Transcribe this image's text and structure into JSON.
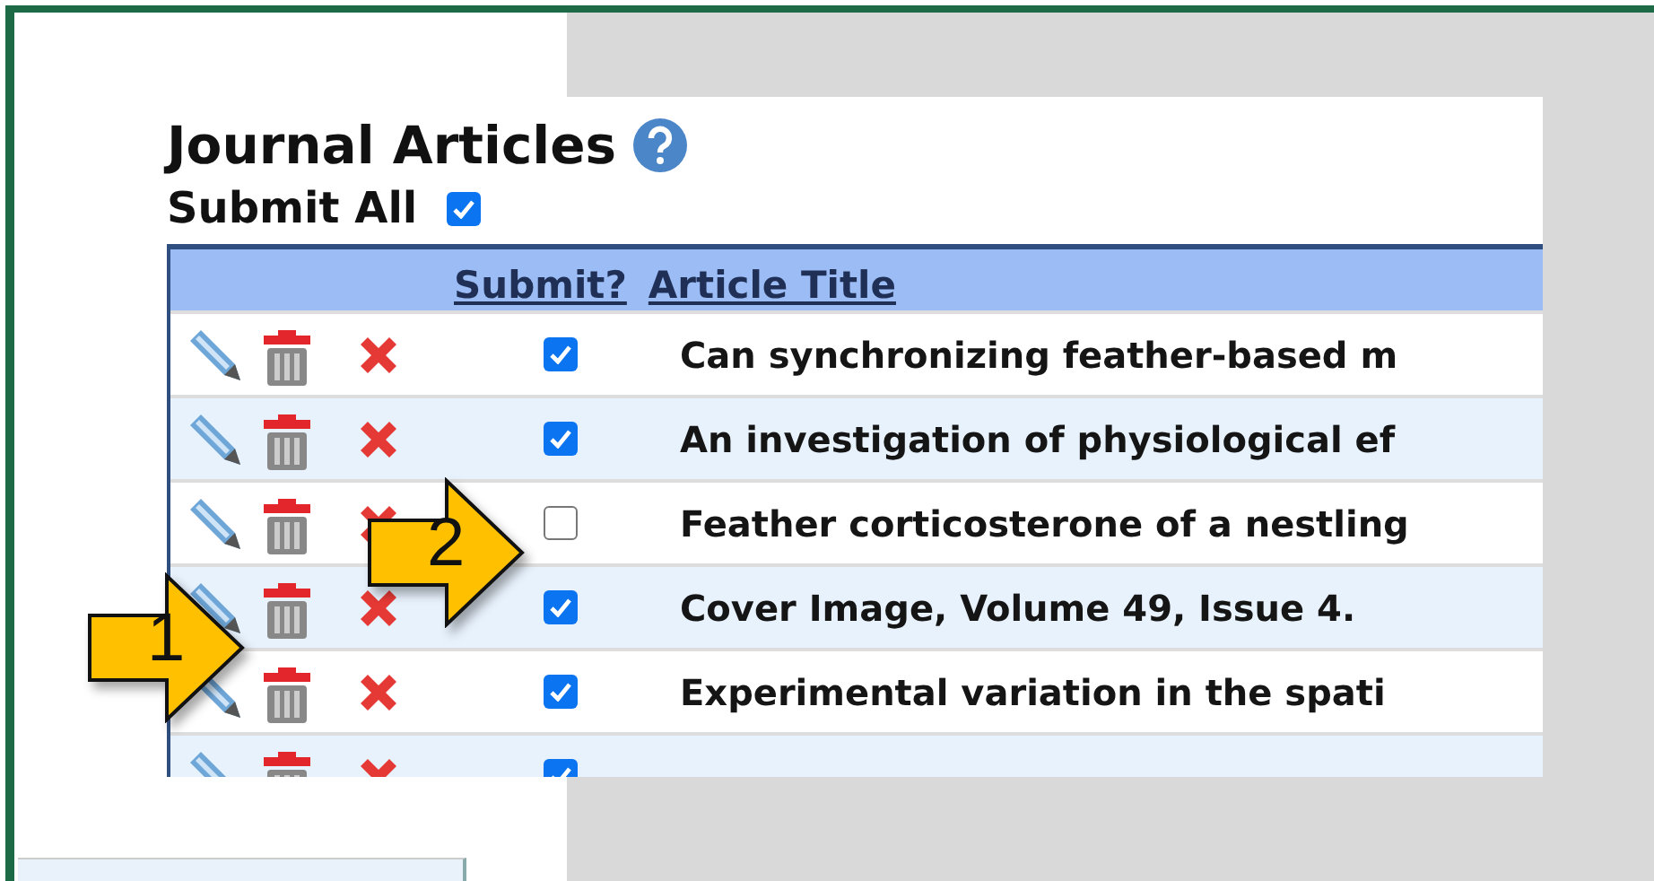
{
  "heading": {
    "title": "Journal Articles"
  },
  "submit_all": {
    "label": "Submit All",
    "checked": true
  },
  "table": {
    "columns": [
      "Submit?",
      "Article Title"
    ],
    "rows": [
      {
        "checked": true,
        "title": "Can synchronizing feather-based m"
      },
      {
        "checked": true,
        "title": "An investigation of physiological ef"
      },
      {
        "checked": false,
        "title": "Feather corticosterone of a nestling"
      },
      {
        "checked": true,
        "title": "Cover Image, Volume 49, Issue 4."
      },
      {
        "checked": true,
        "title": "Experimental variation in the spati"
      },
      {
        "checked": true
      }
    ]
  },
  "callouts": [
    {
      "label": "1"
    },
    {
      "label": "2"
    }
  ]
}
